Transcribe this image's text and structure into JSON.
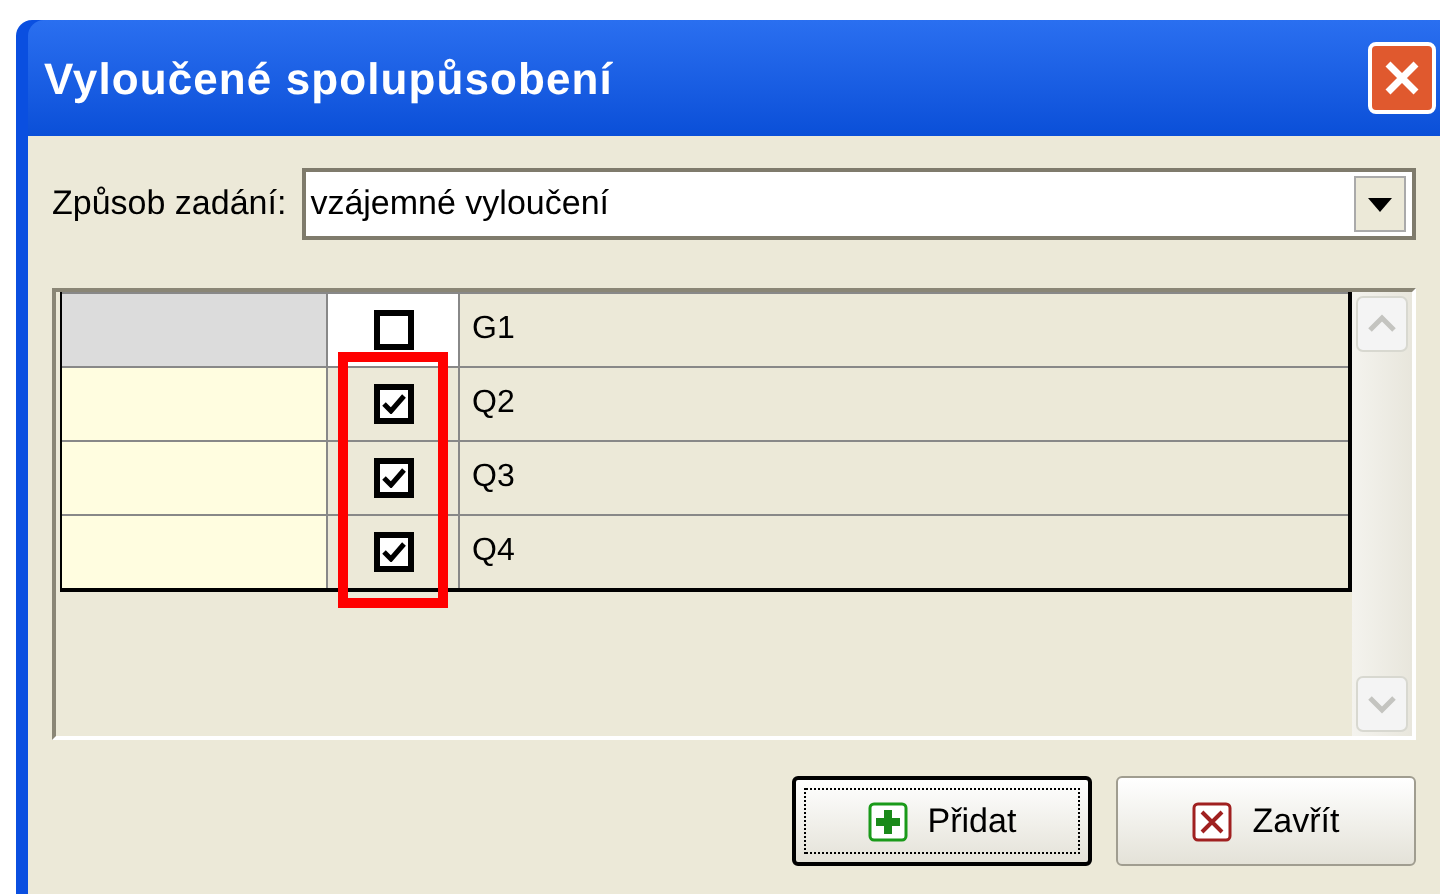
{
  "window": {
    "title": "Vyloučené spolupůsobení"
  },
  "mode": {
    "label": "Způsob zadání:",
    "value": "vzájemné vyloučení"
  },
  "rows": [
    {
      "name": "G1",
      "checked": false,
      "selected": true
    },
    {
      "name": "Q2",
      "checked": true,
      "selected": false
    },
    {
      "name": "Q3",
      "checked": true,
      "selected": false
    },
    {
      "name": "Q4",
      "checked": true,
      "selected": false
    }
  ],
  "buttons": [
    {
      "label": "Přidat",
      "kind": "add",
      "focused": true
    },
    {
      "label": "Zavřít",
      "kind": "close",
      "focused": false
    }
  ]
}
